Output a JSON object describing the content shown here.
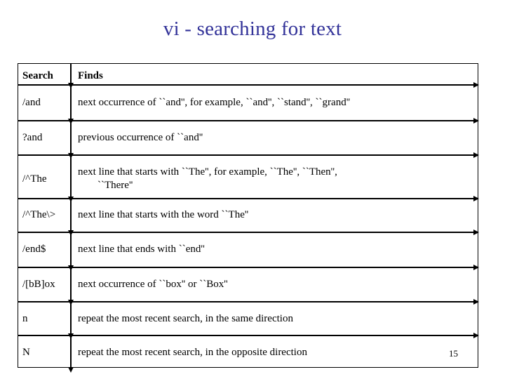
{
  "slide": {
    "title": "vi - searching for text",
    "title_color": "#333399",
    "page_number": "15"
  },
  "table": {
    "columns": [
      {
        "key": "search",
        "header": "Search"
      },
      {
        "key": "finds",
        "header": "Finds"
      }
    ],
    "rows": [
      {
        "search": "/and",
        "finds": "next occurrence of ``and'', for example, ``and'', ``stand'', ``grand''",
        "finds_line1": "next occurrence of ``and'', for example, ``and'', ``stand'', ``grand''",
        "finds_line2": ""
      },
      {
        "search": "?and",
        "finds": "previous occurrence of ``and''",
        "finds_line1": "previous occurrence of ``and''",
        "finds_line2": ""
      },
      {
        "search": "/^The",
        "finds": "next line that starts with ``The'', for example, ``The'', ``Then'', ``There''",
        "finds_line1": "next line that starts with ``The'', for example, ``The'', ``Then'',",
        "finds_line2": "``There''"
      },
      {
        "search": "/^The\\>",
        "finds": "next line that starts with the word ``The''",
        "finds_line1": "next line that starts with the word ``The''",
        "finds_line2": ""
      },
      {
        "search": "/end$",
        "finds": "next line that ends with ``end''",
        "finds_line1": "next line that ends with ``end''",
        "finds_line2": ""
      },
      {
        "search": "/[bB]ox",
        "finds": "next occurrence of ``box'' or ``Box''",
        "finds_line1": "next occurrence of ``box'' or ``Box''",
        "finds_line2": ""
      },
      {
        "search": "n",
        "finds": "repeat the most recent search, in the same direction",
        "finds_line1": "repeat the most recent search, in the same direction",
        "finds_line2": ""
      },
      {
        "search": "N",
        "finds": "repeat the most recent search, in the opposite direction",
        "finds_line1": "repeat the most recent search, in the opposite direction",
        "finds_line2": ""
      }
    ]
  }
}
